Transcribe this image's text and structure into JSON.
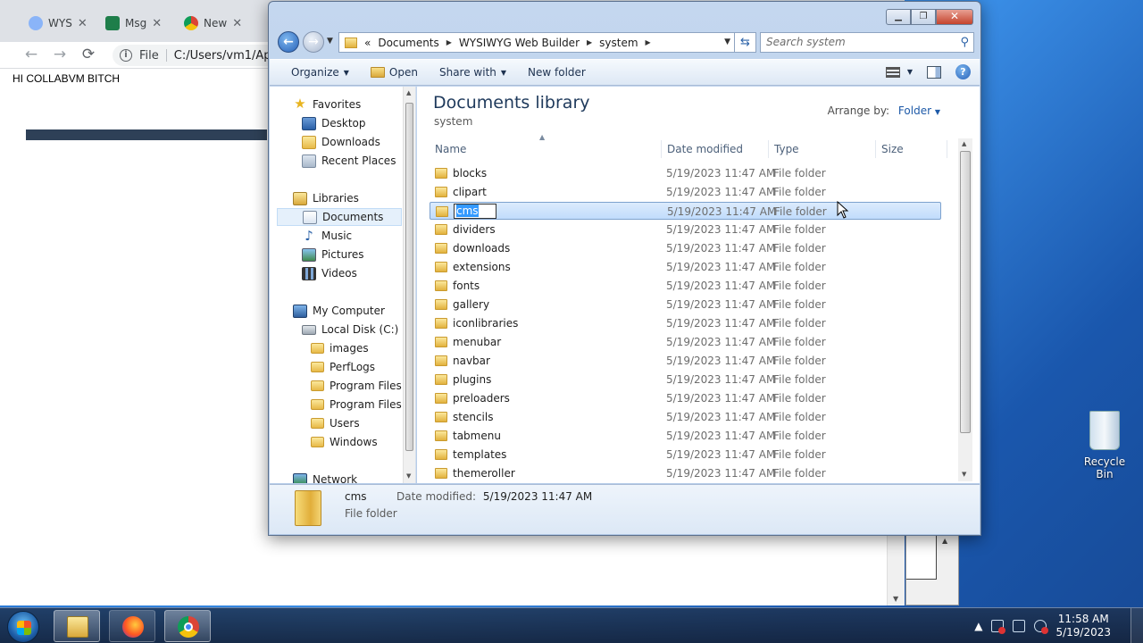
{
  "browser": {
    "tabs": [
      {
        "label": "WYS",
        "icon": "globe-icon",
        "color": "#8ab4f8"
      },
      {
        "label": "Msg",
        "icon": "msg-icon",
        "color": "#1e7e4a"
      },
      {
        "label": "New",
        "icon": "chrome-icon",
        "color": "#4285f4"
      }
    ],
    "close_glyph": "✕",
    "nav": {
      "back": "←",
      "forward": "→",
      "reload": "⟳"
    },
    "address": {
      "scheme": "File",
      "url": "C:/Users/vm1/Ap"
    },
    "page_text": "HI COLLABVM BITCH"
  },
  "explorer": {
    "caption_buttons": {
      "minimize": "▁",
      "maximize": "❐",
      "close": "✕"
    },
    "breadcrumb": [
      "Documents",
      "WYSIWYG Web Builder",
      "system"
    ],
    "breadcrumb_prefix": "«",
    "search_placeholder": "Search system",
    "commands": {
      "organize": "Organize",
      "open": "Open",
      "share_with": "Share with",
      "new_folder": "New folder"
    },
    "nav_pane": {
      "favorites": "Favorites",
      "desktop": "Desktop",
      "downloads": "Downloads",
      "recent_places": "Recent Places",
      "libraries": "Libraries",
      "documents": "Documents",
      "music": "Music",
      "pictures": "Pictures",
      "videos": "Videos",
      "my_computer": "My Computer",
      "local_disk": "Local Disk (C:)",
      "disk_folders": [
        "images",
        "PerfLogs",
        "Program Files",
        "Program Files (",
        "Users",
        "Windows"
      ],
      "network": "Network"
    },
    "library": {
      "title": "Documents library",
      "subtitle": "system",
      "arrange_label": "Arrange by:",
      "arrange_value": "Folder"
    },
    "columns": {
      "name": "Name",
      "date": "Date modified",
      "type": "Type",
      "size": "Size"
    },
    "files": [
      {
        "name": "blocks",
        "date": "5/19/2023 11:47 AM",
        "type": "File folder"
      },
      {
        "name": "clipart",
        "date": "5/19/2023 11:47 AM",
        "type": "File folder"
      },
      {
        "name": "cms",
        "date": "5/19/2023 11:47 AM",
        "type": "File folder"
      },
      {
        "name": "dividers",
        "date": "5/19/2023 11:47 AM",
        "type": "File folder"
      },
      {
        "name": "downloads",
        "date": "5/19/2023 11:47 AM",
        "type": "File folder"
      },
      {
        "name": "extensions",
        "date": "5/19/2023 11:47 AM",
        "type": "File folder"
      },
      {
        "name": "fonts",
        "date": "5/19/2023 11:47 AM",
        "type": "File folder"
      },
      {
        "name": "gallery",
        "date": "5/19/2023 11:47 AM",
        "type": "File folder"
      },
      {
        "name": "iconlibraries",
        "date": "5/19/2023 11:47 AM",
        "type": "File folder"
      },
      {
        "name": "menubar",
        "date": "5/19/2023 11:47 AM",
        "type": "File folder"
      },
      {
        "name": "navbar",
        "date": "5/19/2023 11:47 AM",
        "type": "File folder"
      },
      {
        "name": "plugins",
        "date": "5/19/2023 11:47 AM",
        "type": "File folder"
      },
      {
        "name": "preloaders",
        "date": "5/19/2023 11:47 AM",
        "type": "File folder"
      },
      {
        "name": "stencils",
        "date": "5/19/2023 11:47 AM",
        "type": "File folder"
      },
      {
        "name": "tabmenu",
        "date": "5/19/2023 11:47 AM",
        "type": "File folder"
      },
      {
        "name": "templates",
        "date": "5/19/2023 11:47 AM",
        "type": "File folder"
      },
      {
        "name": "themeroller",
        "date": "5/19/2023 11:47 AM",
        "type": "File folder"
      }
    ],
    "selected_file": "cms",
    "details": {
      "name": "cms",
      "type": "File folder",
      "modified_label": "Date modified:",
      "modified_value": "5/19/2023 11:47 AM"
    }
  },
  "desktop": {
    "recycle_bin": "Recycle Bin"
  },
  "taskbar": {
    "buttons": [
      "windows-explorer",
      "firefox",
      "chrome"
    ],
    "tray_arrow": "▲",
    "time": "11:58 AM",
    "date": "5/19/2023"
  },
  "colors": {
    "accent": "#1e395b",
    "selection": "#c1dcfc",
    "taskbar": "#1e3250"
  }
}
